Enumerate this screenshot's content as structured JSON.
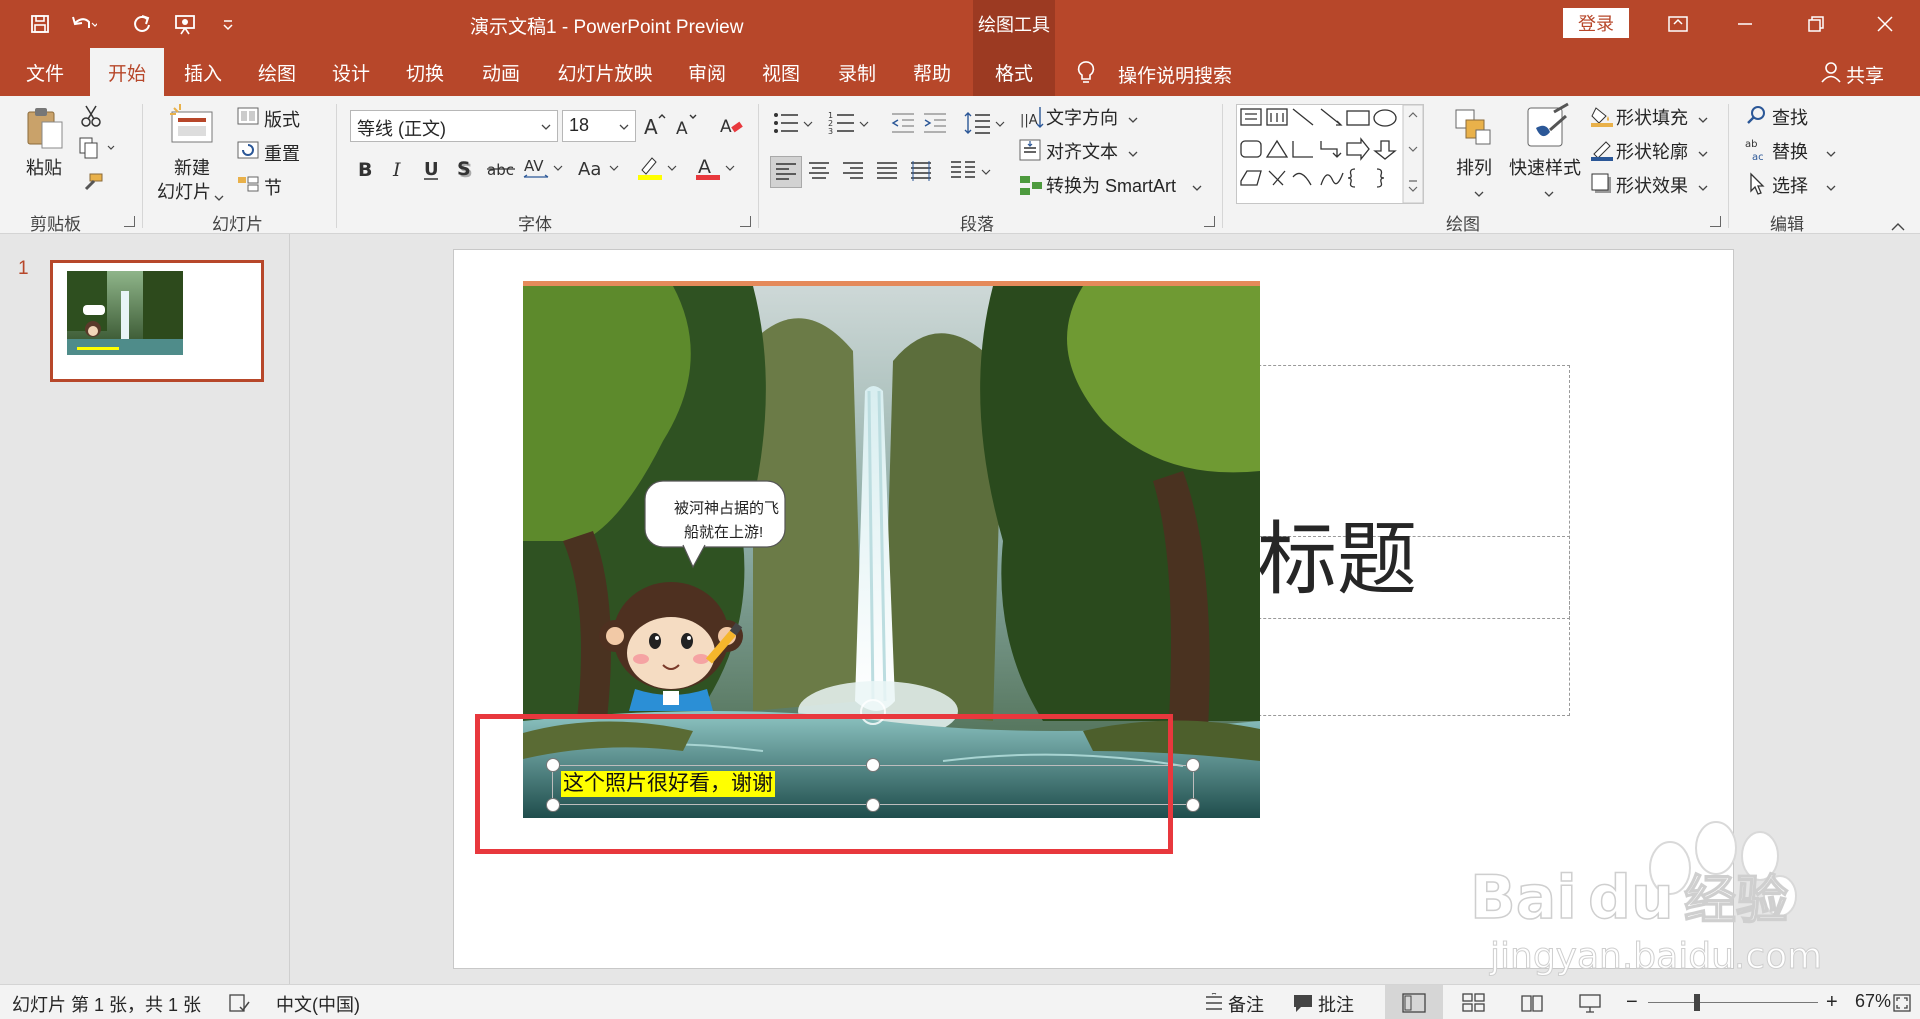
{
  "app": {
    "document_title": "演示文稿1 - PowerPoint Preview",
    "contextual_tools_label": "绘图工具",
    "login_label": "登录"
  },
  "tabs": [
    {
      "label": "文件",
      "state": "normal"
    },
    {
      "label": "开始",
      "state": "active"
    },
    {
      "label": "插入",
      "state": "normal"
    },
    {
      "label": "绘图",
      "state": "normal"
    },
    {
      "label": "设计",
      "state": "normal"
    },
    {
      "label": "切换",
      "state": "normal"
    },
    {
      "label": "动画",
      "state": "normal"
    },
    {
      "label": "幻灯片放映",
      "state": "normal"
    },
    {
      "label": "审阅",
      "state": "normal"
    },
    {
      "label": "视图",
      "state": "normal"
    },
    {
      "label": "录制",
      "state": "normal"
    },
    {
      "label": "帮助",
      "state": "normal"
    },
    {
      "label": "格式",
      "state": "contextual"
    }
  ],
  "search": {
    "label": "操作说明搜索"
  },
  "share": {
    "label": "共享"
  },
  "ribbon": {
    "clipboard": {
      "paste": "粘贴",
      "group": "剪贴板"
    },
    "slides": {
      "new_slide_line1": "新建",
      "new_slide_line2": "幻灯片",
      "layout": "版式",
      "reset": "重置",
      "section": "节",
      "group": "幻灯片"
    },
    "font": {
      "font_name": "等线 (正文)",
      "font_size": "18",
      "group": "字体"
    },
    "paragraph": {
      "text_direction": "文字方向",
      "align_text": "对齐文本",
      "convert_smartart": "转换为 SmartArt",
      "group": "段落"
    },
    "drawing": {
      "arrange": "排列",
      "quick_styles": "快速样式",
      "shape_fill": "形状填充",
      "shape_outline": "形状轮廓",
      "shape_effects": "形状效果",
      "group": "绘图"
    },
    "editing": {
      "find": "查找",
      "replace": "替换",
      "select": "选择",
      "group": "编辑"
    }
  },
  "thumbnails": [
    {
      "number": "1"
    }
  ],
  "slide": {
    "title_placeholder": "标题",
    "speech_bubble_line1": "被河神占据的飞",
    "speech_bubble_line2": "船就在上游!",
    "caption_text": "这个照片很好看，谢谢"
  },
  "status": {
    "slide_info": "幻灯片 第 1 张，共 1 张",
    "language": "中文(中国)",
    "notes": "备注",
    "comments": "批注",
    "zoom": "67%"
  },
  "watermark": {
    "brand": "Baidu经验",
    "url": "jingyan.baidu.com"
  },
  "colors": {
    "accent": "#b7472a",
    "accent_dark": "#9c3a22",
    "highlight_box": "#e8383d",
    "caption_highlight": "#ffff00"
  }
}
